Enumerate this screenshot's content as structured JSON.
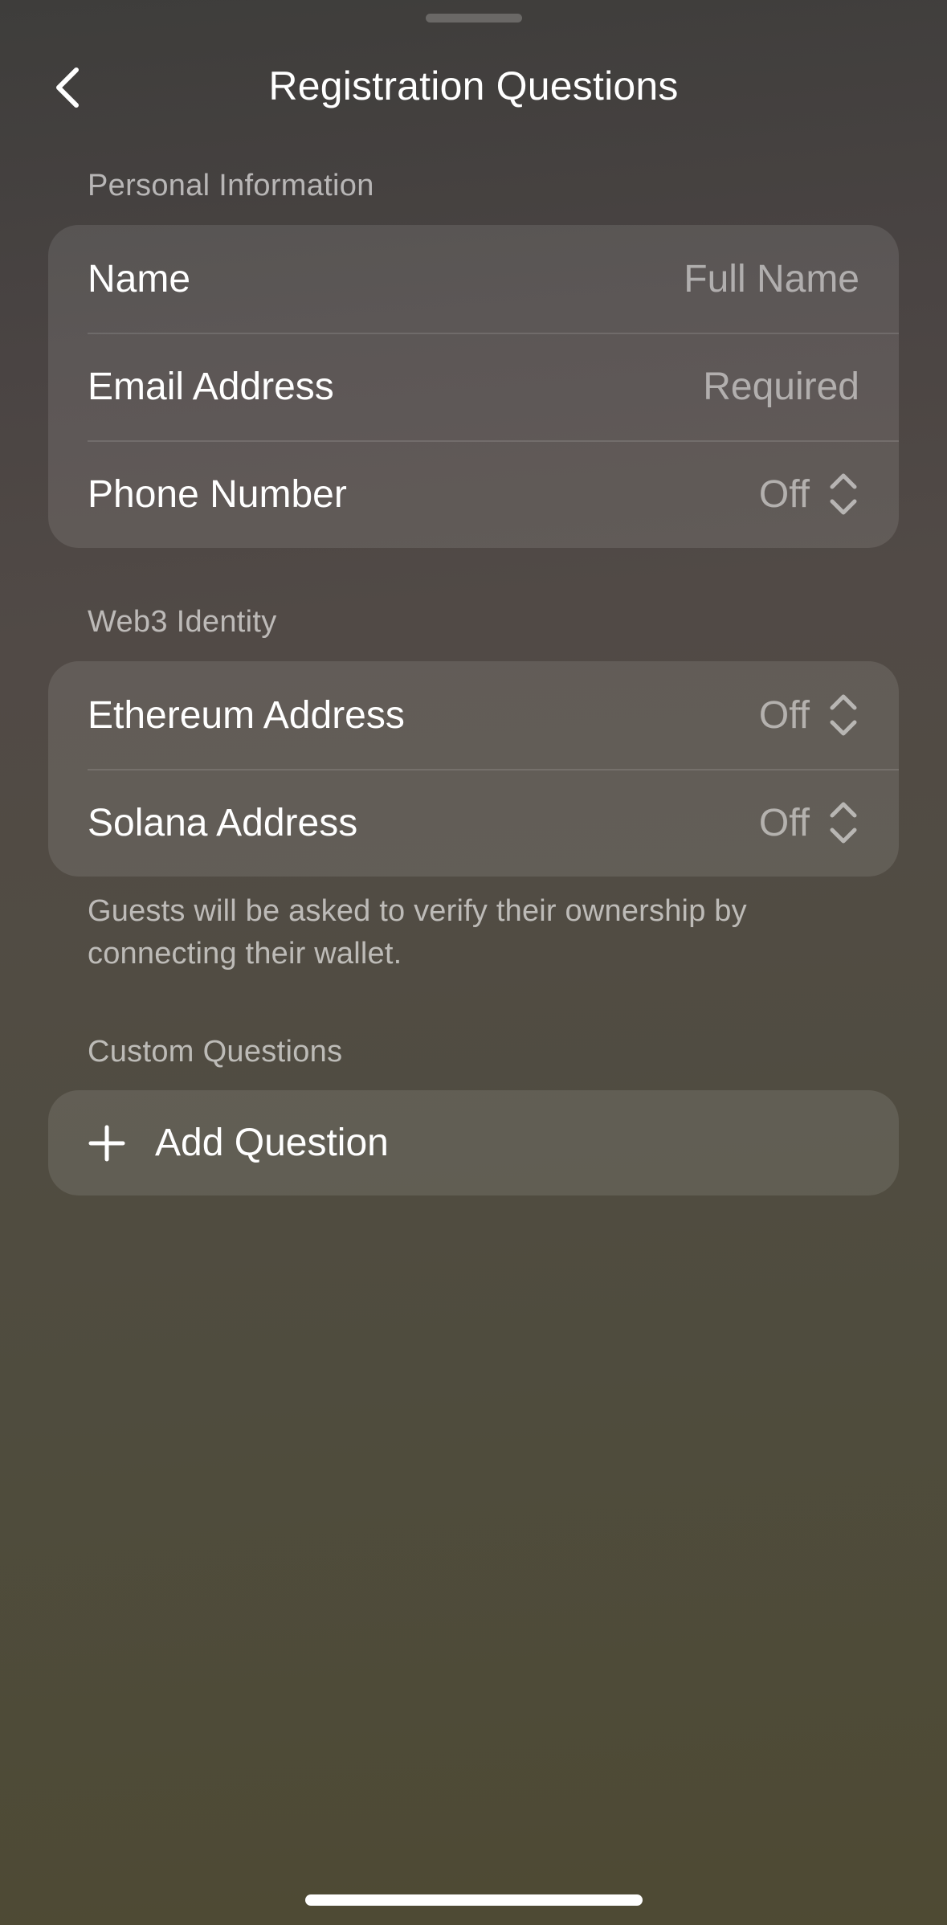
{
  "header": {
    "title": "Registration Questions"
  },
  "sections": {
    "personal": {
      "label": "Personal Information",
      "rows": [
        {
          "label": "Name",
          "value": "Full Name"
        },
        {
          "label": "Email Address",
          "value": "Required"
        },
        {
          "label": "Phone Number",
          "value": "Off"
        }
      ]
    },
    "web3": {
      "label": "Web3 Identity",
      "rows": [
        {
          "label": "Ethereum Address",
          "value": "Off"
        },
        {
          "label": "Solana Address",
          "value": "Off"
        }
      ],
      "note": "Guests will be asked to verify their ownership by connecting their wallet."
    },
    "custom": {
      "label": "Custom Questions",
      "add_label": "Add Question"
    }
  },
  "icons": {
    "back": "chevron-left-icon",
    "selector": "chevron-up-down-icon",
    "add": "plus-icon"
  }
}
